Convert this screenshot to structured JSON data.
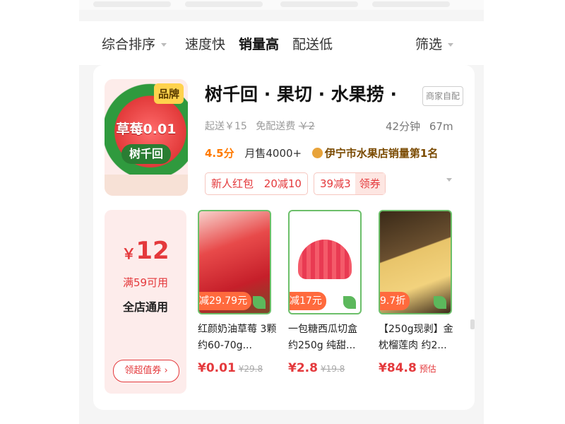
{
  "sort_bar": {
    "items": [
      {
        "label": "综合排序"
      },
      {
        "label": "速度快"
      },
      {
        "label": "销量高"
      },
      {
        "label": "配送低"
      }
    ],
    "filter_label": "筛选"
  },
  "store": {
    "logo": {
      "brand_badge": "品牌",
      "slogan": "草莓0.01",
      "name": "树千回"
    },
    "title": "树千回 · 果切 · 水果捞 ·",
    "tag": "商家自配",
    "min_order": "起送￥15",
    "free_delivery": "免配送费",
    "orig_delivery_fee": "￥2",
    "delivery_time": "42分钟",
    "distance": "67m",
    "rating": "4.5分",
    "monthly_sales": "月售4000+",
    "rank": "伊宁市水果店销量第1名",
    "coupons": [
      {
        "label": "新人红包"
      },
      {
        "label": "20减10"
      },
      {
        "label": "39减3",
        "claim": "领券"
      }
    ]
  },
  "voucher": {
    "currency": "￥",
    "amount": "12",
    "condition": "满59可用",
    "scope": "全店通用",
    "button": "领超值券 ›"
  },
  "products": [
    {
      "discount": "减29.79元",
      "name": "红颜奶油草莓 3颗 约60-70g...",
      "price": "¥0.01",
      "original": "¥29.8",
      "extra": ""
    },
    {
      "discount": "减17元",
      "name": "一包糖西瓜切盒 约250g 纯甜...",
      "price": "¥2.8",
      "original": "¥19.8",
      "extra": ""
    },
    {
      "discount": "9.7折",
      "name": "【250g现剥】金枕榴莲肉 约2...",
      "price": "¥84.8",
      "original": "",
      "extra": "预估"
    }
  ],
  "colors": {
    "accent_red": "#e4393c",
    "rating_orange": "#ff7a00",
    "discount_orange": "#ff6a3d"
  }
}
